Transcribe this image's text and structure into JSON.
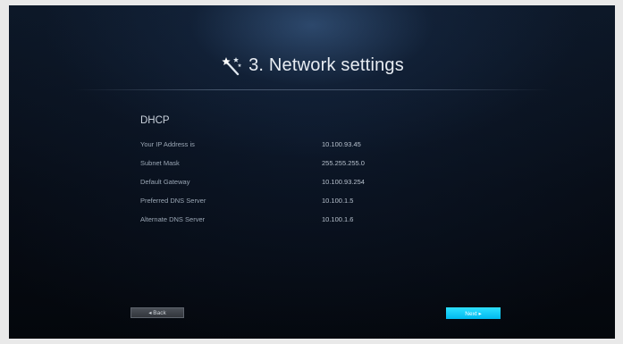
{
  "header": {
    "icon": "magic-wand-icon",
    "title": "3. Network settings"
  },
  "section": {
    "heading": "DHCP",
    "rows": [
      {
        "label": "Your IP Address is",
        "value": "10.100.93.45"
      },
      {
        "label": "Subnet Mask",
        "value": "255.255.255.0"
      },
      {
        "label": "Default Gateway",
        "value": "10.100.93.254"
      },
      {
        "label": "Preferred DNS Server",
        "value": "10.100.1.5"
      },
      {
        "label": "Alternate DNS Server",
        "value": "10.100.1.6"
      }
    ]
  },
  "footer": {
    "back_label": "◂ Back",
    "next_label": "Next ▸"
  },
  "colors": {
    "background": "#070c15",
    "accent": "#00c8f5",
    "text": "#e8edf3"
  }
}
